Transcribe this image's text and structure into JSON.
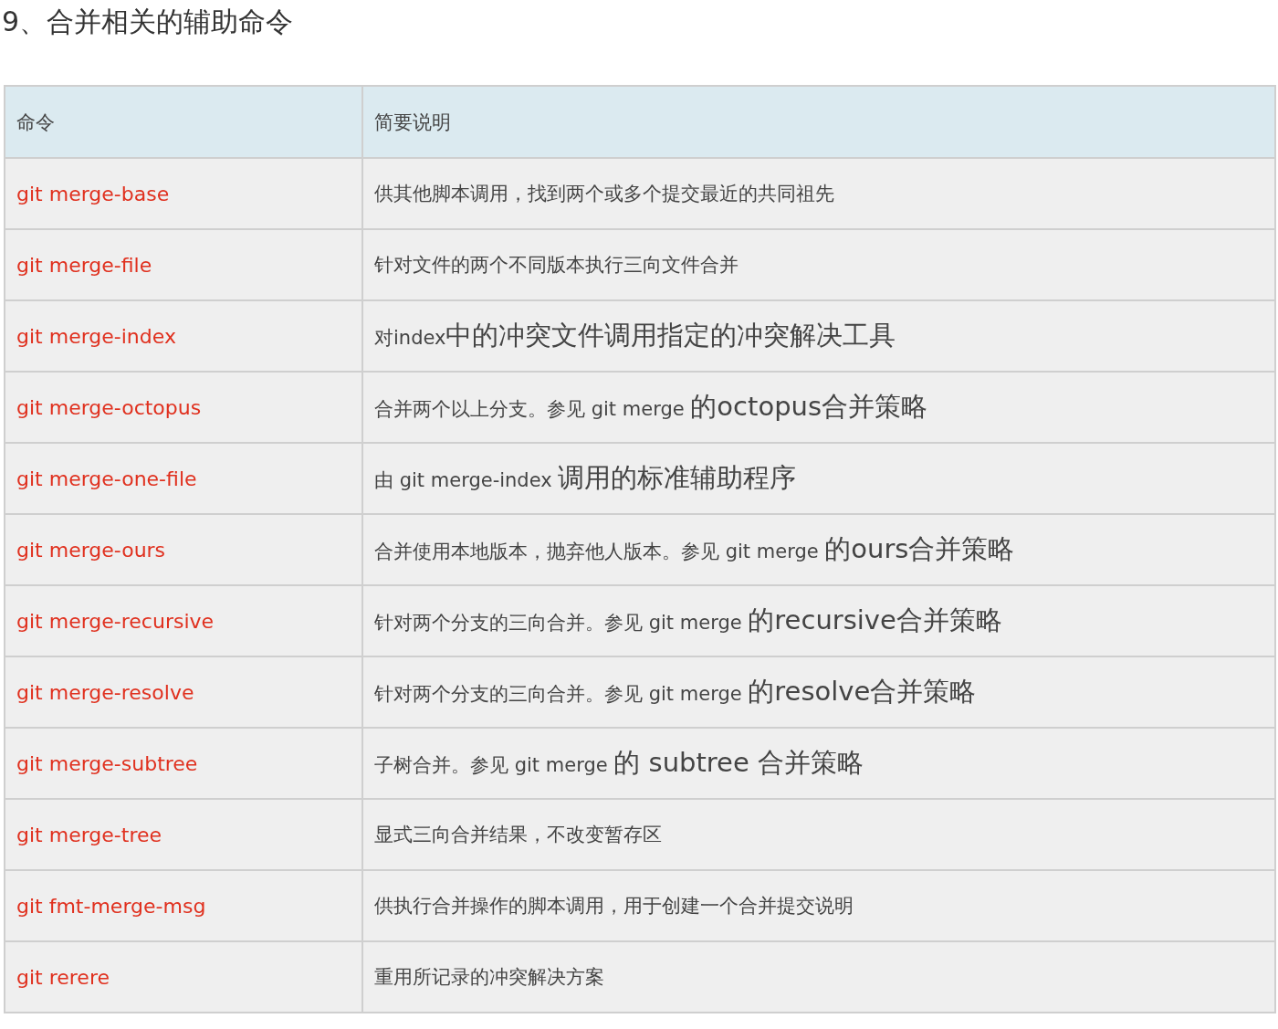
{
  "heading": "9、合并相关的辅助命令",
  "table": {
    "columns": [
      "命令",
      "简要说明"
    ],
    "rows": [
      {
        "command": "git merge-base",
        "description": [
          {
            "text": "供其他脚本调用，找到两个或多个提交最近的共同祖先",
            "large": false
          }
        ]
      },
      {
        "command": "git merge-file",
        "description": [
          {
            "text": "针对文件的两个不同版本执行三向文件合并",
            "large": false
          }
        ]
      },
      {
        "command": "git merge-index",
        "description": [
          {
            "text": "对index",
            "large": false
          },
          {
            "text": "中的冲突文件调用指定的冲突解决工具",
            "large": true
          }
        ]
      },
      {
        "command": "git merge-octopus",
        "description": [
          {
            "text": "合并两个以上分支。参见 git merge ",
            "large": false
          },
          {
            "text": "的octopus合并策略",
            "large": true
          }
        ]
      },
      {
        "command": "git merge-one-file",
        "description": [
          {
            "text": "由 git merge-index ",
            "large": false
          },
          {
            "text": "调用的标准辅助程序",
            "large": true
          }
        ]
      },
      {
        "command": "git merge-ours",
        "description": [
          {
            "text": "合并使用本地版本，抛弃他人版本。参见 git merge ",
            "large": false
          },
          {
            "text": "的ours合并策略",
            "large": true
          }
        ]
      },
      {
        "command": "git merge-recursive",
        "description": [
          {
            "text": "针对两个分支的三向合并。参见 git merge ",
            "large": false
          },
          {
            "text": "的recursive合并策略",
            "large": true
          }
        ]
      },
      {
        "command": "git merge-resolve",
        "description": [
          {
            "text": "针对两个分支的三向合并。参见 git merge ",
            "large": false
          },
          {
            "text": "的resolve合并策略",
            "large": true
          }
        ]
      },
      {
        "command": "git merge-subtree",
        "description": [
          {
            "text": "子树合并。参见 git merge ",
            "large": false
          },
          {
            "text": "的 subtree 合并策略",
            "large": true
          }
        ]
      },
      {
        "command": "git merge-tree",
        "description": [
          {
            "text": "显式三向合并结果，不改变暂存区",
            "large": false
          }
        ]
      },
      {
        "command": "git fmt-merge-msg",
        "description": [
          {
            "text": "供执行合并操作的脚本调用，用于创建一个合并提交说明",
            "large": false
          }
        ]
      },
      {
        "command": "git rerere",
        "description": [
          {
            "text": "重用所记录的冲突解决方案",
            "large": false
          }
        ]
      }
    ]
  }
}
